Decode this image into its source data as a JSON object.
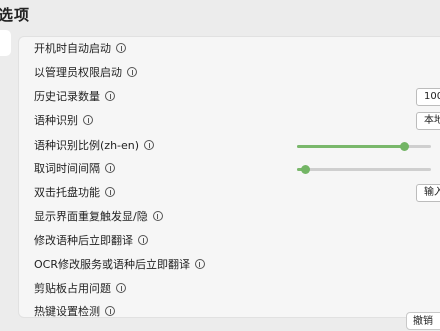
{
  "window": {
    "title": "选项"
  },
  "settings": [
    {
      "label": "开机时自动启动"
    },
    {
      "label": "以管理员权限启动"
    },
    {
      "label": "历史记录数量",
      "value": "100"
    },
    {
      "label": "语种识别",
      "value": "本地"
    },
    {
      "label": "语种识别比例(zh-en)",
      "slider": 0.8
    },
    {
      "label": "取词时间间隔",
      "slider": 0.06
    },
    {
      "label": "双击托盘功能",
      "value": "输入"
    },
    {
      "label": "显示界面重复触发显/隐"
    },
    {
      "label": "修改语种后立即翻译"
    },
    {
      "label": "OCR修改服务或语种后立即翻译"
    },
    {
      "label": "剪贴板占用问题"
    },
    {
      "label": "热键设置检测"
    }
  ],
  "footer": {
    "cancel_label": "撤销"
  },
  "colors": {
    "accent": "#73b565",
    "panel": "#f6f6f6",
    "background": "#ececec"
  }
}
